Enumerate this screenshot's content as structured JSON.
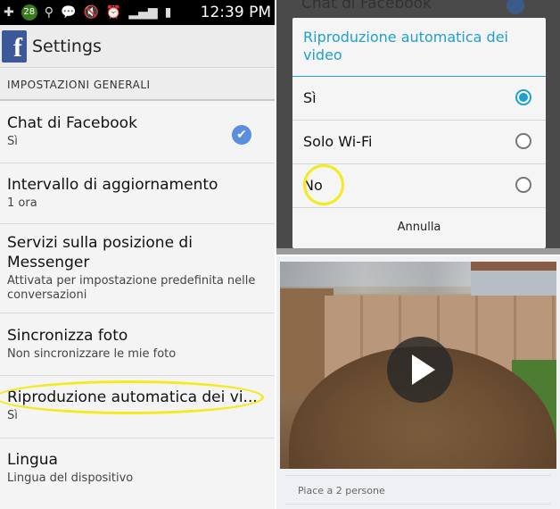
{
  "status_bar": {
    "notification_count": "28",
    "time": "12:39 PM",
    "icons": [
      "plus-icon",
      "usb-icon",
      "messenger-icon",
      "mute-icon",
      "alarm-icon",
      "signal-icon",
      "battery-icon"
    ]
  },
  "app_bar": {
    "logo": "f",
    "title": "Settings"
  },
  "section": {
    "header": "IMPOSTAZIONI GENERALI"
  },
  "preferences": [
    {
      "title": "Chat di Facebook",
      "summary": "Sì",
      "checked": true
    },
    {
      "title": "Intervallo di aggiornamento",
      "summary": "1 ora"
    },
    {
      "title": "Servizi sulla posizione di Messenger",
      "summary": "Attivata per impostazione predefinita nelle conversazioni"
    },
    {
      "title": "Sincronizza foto",
      "summary": "Non sincronizzare le mie foto"
    },
    {
      "title": "Riproduzione automatica dei vi...",
      "summary": "Sì"
    },
    {
      "title": "Lingua",
      "summary": "Lingua del dispositivo"
    }
  ],
  "background_peek": {
    "title": "Chat di Facebook"
  },
  "dialog": {
    "title": "Riproduzione automatica dei video",
    "options": [
      {
        "label": "Sì",
        "selected": true
      },
      {
        "label": "Solo Wi-Fi",
        "selected": false
      },
      {
        "label": "No",
        "selected": false
      }
    ],
    "cancel_label": "Annulla"
  },
  "post": {
    "likes_text": "Piace a 2 persone"
  },
  "colors": {
    "facebook_blue": "#3b5998",
    "accent": "#1e9fcf",
    "highlight": "#f4ea1c",
    "check": "#5b8fdd"
  }
}
